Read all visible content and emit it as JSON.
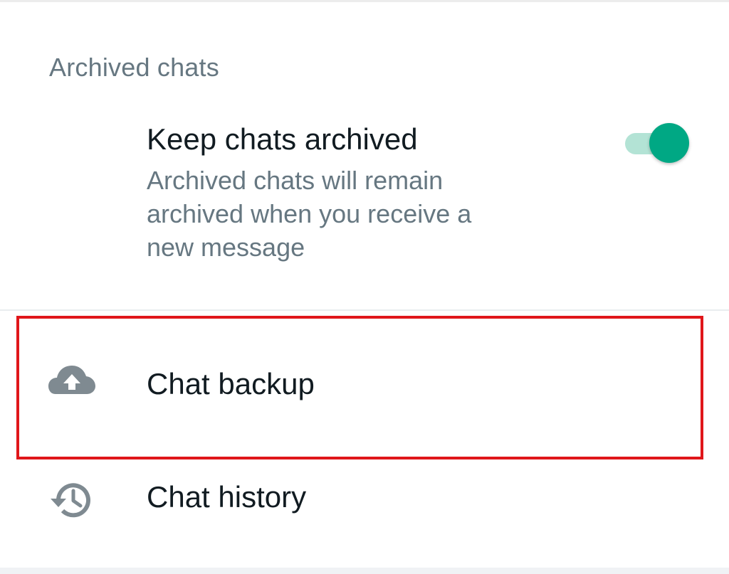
{
  "section": {
    "header": "Archived chats"
  },
  "keep_archived": {
    "title": "Keep chats archived",
    "description": "Archived chats will remain archived when you receive a new message",
    "enabled": true
  },
  "rows": {
    "backup": {
      "label": "Chat backup",
      "icon": "cloud-upload-icon"
    },
    "history": {
      "label": "Chat history",
      "icon": "history-icon"
    }
  },
  "colors": {
    "accent": "#00a884",
    "accent_track": "#b3e3d5",
    "secondary_text": "#667781",
    "primary_text": "#111b21",
    "icon": "#7f8a91",
    "highlight": "#e0161a"
  }
}
